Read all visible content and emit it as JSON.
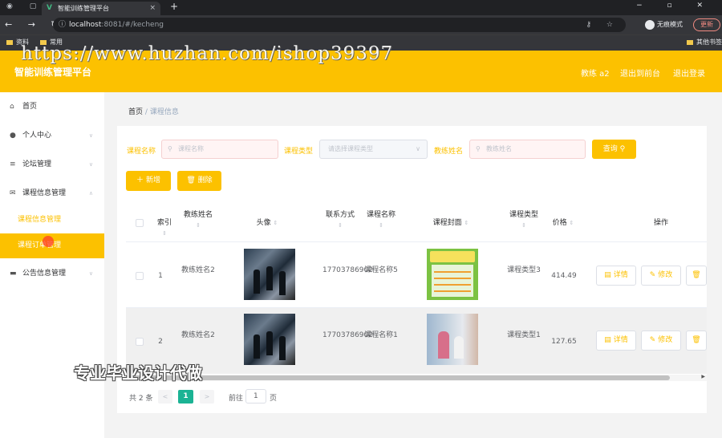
{
  "browser": {
    "tab_title": "智能训练管理平台",
    "tab_close": "×",
    "new_tab": "+",
    "url_host": "localhost",
    "url_path": ":8081/#/kecheng",
    "profile": "无痕模式",
    "update_button": "更新",
    "bookmarks": [
      "资料",
      "常用",
      "其他书签"
    ]
  },
  "watermark_url": "https://www.huzhan.com/ishop39397",
  "watermark_ad": "专业毕业设计代做",
  "header": {
    "brand": "智能训练管理平台",
    "user": "教练 a2",
    "back_to_admin": "退出到前台",
    "logout": "退出登录",
    "bg_color": "#fcc100"
  },
  "sidebar": {
    "items": [
      {
        "label": "首页",
        "icon": "home-icon"
      },
      {
        "label": "个人中心",
        "icon": "user-icon"
      },
      {
        "label": "论坛管理",
        "icon": "list-icon"
      },
      {
        "label": "课程信息管理",
        "icon": "mail-icon"
      },
      {
        "label": "公告信息管理",
        "icon": "card-icon"
      }
    ],
    "sub_items": [
      "课程信息管理",
      "课程订单管理"
    ]
  },
  "breadcrumb": {
    "home": "首页",
    "separator": "/",
    "current": "课程信息"
  },
  "filters": {
    "name_label": "课程名称",
    "name_placeholder": "课程名称",
    "type_label": "课程类型",
    "type_placeholder": "请选择课程类型",
    "coach_label": "教练姓名",
    "coach_placeholder": "教练姓名",
    "search_button": "查询"
  },
  "actions": {
    "add": "新增",
    "delete": "删除"
  },
  "table": {
    "columns": [
      "索引",
      "教练姓名",
      "头像",
      "联系方式",
      "课程名称",
      "课程封面",
      "课程类型",
      "价格",
      "操作"
    ],
    "rows": [
      {
        "index": "1",
        "coach": "教练姓名2",
        "phone": "17703786902",
        "course": "课程名称5",
        "type": "课程类型3",
        "price": "414.49"
      },
      {
        "index": "2",
        "coach": "教练姓名2",
        "phone": "17703786902",
        "course": "课程名称1",
        "type": "课程类型1",
        "price": "127.65"
      }
    ],
    "op_detail": "详情",
    "op_edit": "修改",
    "op_delete": "删除"
  },
  "pagination": {
    "total": "共 2 条",
    "prev": "<",
    "current": "1",
    "next": ">",
    "goto": "前往",
    "page_value": "1",
    "page_suffix": "页"
  }
}
